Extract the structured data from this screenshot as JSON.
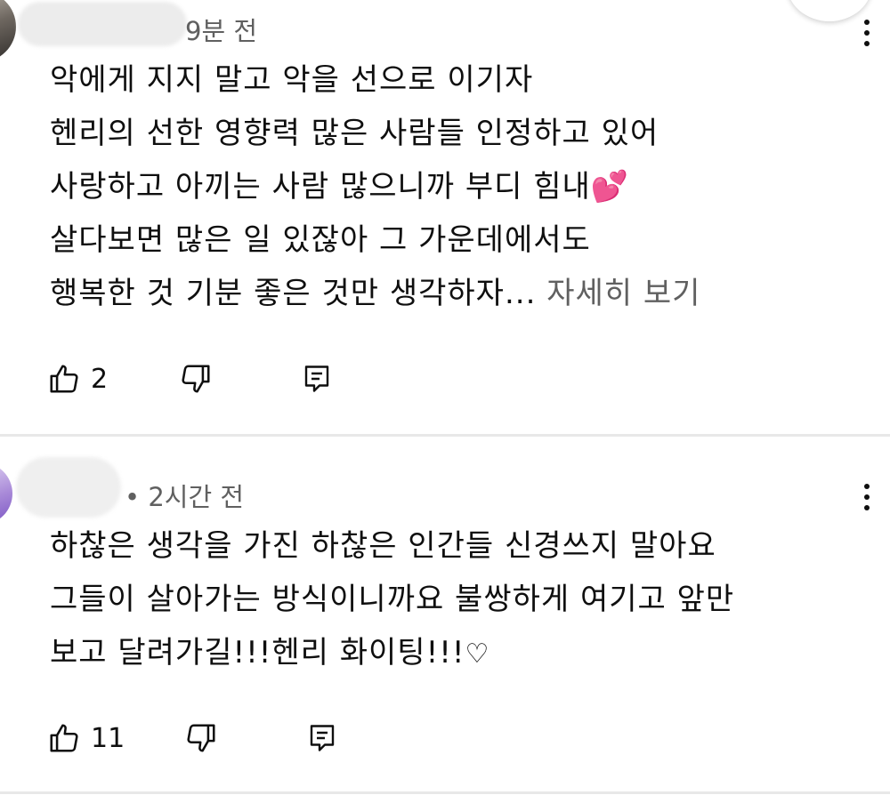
{
  "comments": [
    {
      "time_text": "9분 전",
      "lines": [
        "악에게 지지 말고 악을 선으로 이기자",
        "헨리의 선한 영향력 많은 사람들 인정하고 있어",
        "사랑하고 아끼는 사람 많으니까 부디 힘내",
        "살다보면 많은 일 있잖아 그 가운데에서도",
        "행복한 것 기분 좋은 것만 생각하자..."
      ],
      "line3_emoji": "💕",
      "more_label": "자세히 보기",
      "like_count": "2"
    },
    {
      "time_text": "• 2시간 전",
      "lines": [
        "하찮은 생각을 가진 하찮은 인간들  신경쓰지 말아요",
        "그들이 살아가는 방식이니까요  불쌍하게 여기고 앞만",
        "보고 달려가길!!!헨리 화이팅!!!"
      ],
      "line3_emoji": "♡",
      "like_count": "11"
    }
  ],
  "colors": {
    "text": "#0f0f0f",
    "secondary": "#606060",
    "divider": "#e8e8e8",
    "heart": "#ff3d9a"
  },
  "icons": [
    "thumbs-up-icon",
    "thumbs-down-icon",
    "reply-icon",
    "more-vert-icon"
  ]
}
